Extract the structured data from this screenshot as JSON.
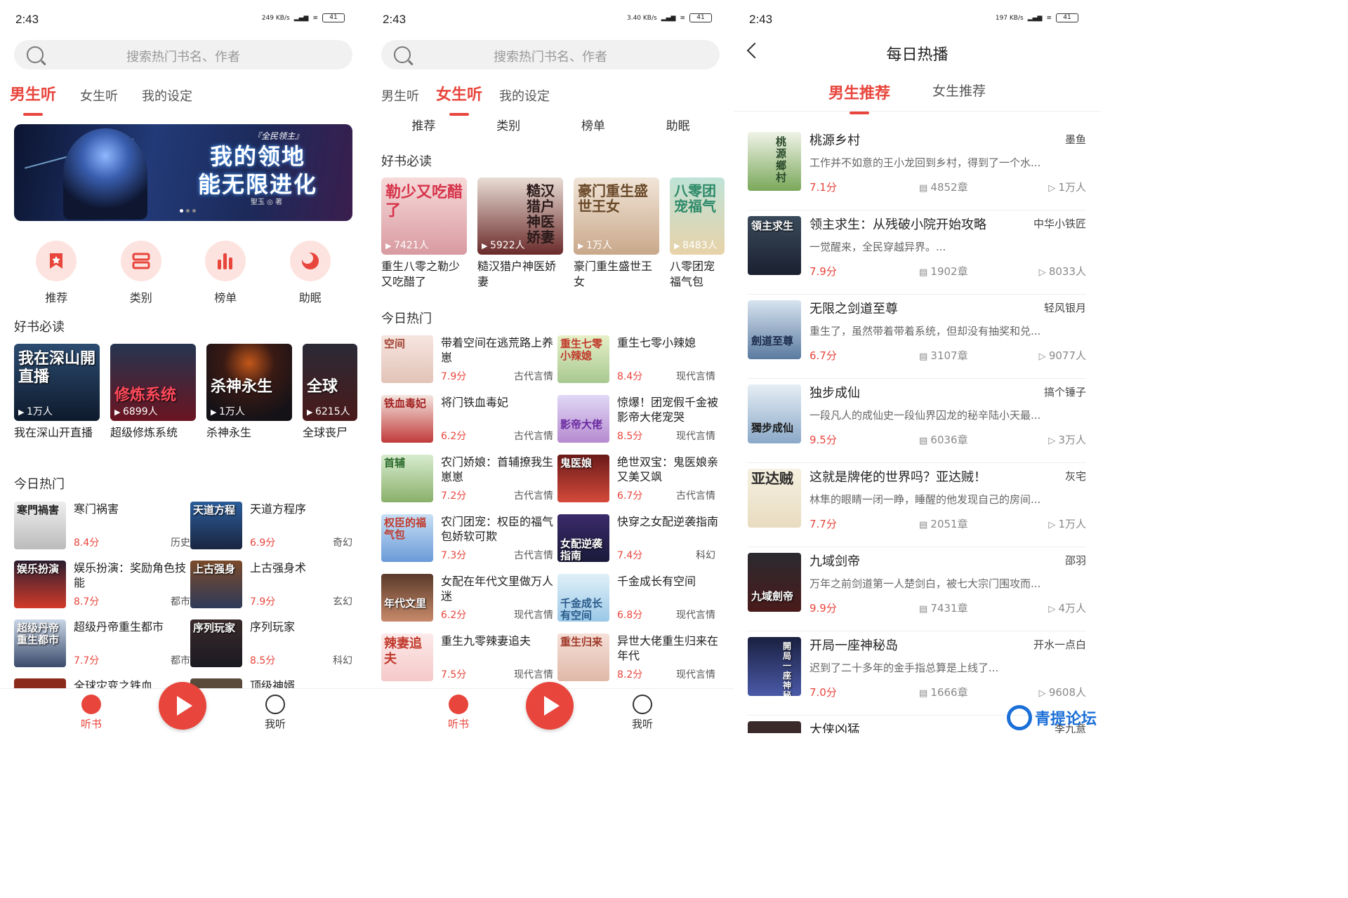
{
  "status": {
    "time": "2:43",
    "speed1": "249 KB/s",
    "speed2": "3.40 KB/s",
    "speed3": "197 KB/s",
    "battery": "41"
  },
  "search": {
    "placeholder": "搜索热门书名、作者"
  },
  "tabs": {
    "male": "男生听",
    "female": "女生听",
    "settings": "我的设定"
  },
  "banner": {
    "tag": "『全民领主』",
    "title_line1": "我的领地",
    "title_line2": "能无限进化",
    "author": "聖玉 ◎ 著"
  },
  "quick": [
    "推荐",
    "类别",
    "榜单",
    "助眠"
  ],
  "sections": {
    "must_read": "好书必读",
    "today_hot": "今日热门"
  },
  "screen1": {
    "must_read": [
      {
        "cover": "我在深山開直播",
        "plays": "1万人",
        "name": "我在深山开直播"
      },
      {
        "cover": "修炼系统",
        "plays": "6899人",
        "name": "超级修炼系统"
      },
      {
        "cover": "杀神永生",
        "plays": "1万人",
        "name": "杀神永生"
      },
      {
        "cover": "全球",
        "plays": "6215人",
        "name": "全球丧尸"
      }
    ],
    "hot": [
      {
        "cover": "寒門禍害",
        "title": "寒门祸害",
        "score": "8.4分",
        "genre": "历史"
      },
      {
        "cover": "天道方程",
        "title": "天道方程序",
        "score": "6.9分",
        "genre": "奇幻"
      },
      {
        "cover": "娱乐扮演",
        "title": "娱乐扮演：奖励角色技能",
        "score": "8.7分",
        "genre": "都市"
      },
      {
        "cover": "上古强身",
        "title": "上古强身术",
        "score": "7.9分",
        "genre": "玄幻"
      },
      {
        "cover": "超级丹帝重生都市",
        "title": "超级丹帝重生都市",
        "score": "7.7分",
        "genre": "都市"
      },
      {
        "cover": "序列玩家",
        "title": "序列玩家",
        "score": "8.5分",
        "genre": "科幻"
      },
      {
        "cover": "",
        "title": "全球灾变之铁血...",
        "score": "",
        "genre": ""
      },
      {
        "cover": "",
        "title": "顶级神婿",
        "score": "",
        "genre": ""
      }
    ]
  },
  "screen2": {
    "subtabs": [
      "推荐",
      "类别",
      "榜单",
      "助眠"
    ],
    "must_read": [
      {
        "cover": "勒少又吃醋了",
        "plays": "7421人",
        "name": "重生八零之勒少又吃醋了"
      },
      {
        "cover": "糙汉猎户神医娇妻",
        "plays": "5922人",
        "name": "糙汉猎户神医娇妻"
      },
      {
        "cover": "豪门重生盛世王女",
        "plays": "1万人",
        "name": "豪门重生盛世王女"
      },
      {
        "cover": "八零团宠福气",
        "plays": "8483人",
        "name": "八零团宠福气包"
      }
    ],
    "hot": [
      {
        "cover": "空间",
        "title": "带着空间在逃荒路上养崽",
        "score": "7.9分",
        "genre": "古代言情"
      },
      {
        "cover": "重生七零小辣媳",
        "title": "重生七零小辣媳",
        "score": "8.4分",
        "genre": "现代言情"
      },
      {
        "cover": "铁血毒妃",
        "title": "将门铁血毒妃",
        "score": "6.2分",
        "genre": "古代言情"
      },
      {
        "cover": "影帝大佬",
        "title": "惊爆！团宠假千金被影帝大佬宠哭",
        "score": "8.5分",
        "genre": "现代言情"
      },
      {
        "cover": "首辅",
        "title": "农门娇娘：首辅撩我生崽崽",
        "score": "7.2分",
        "genre": "古代言情"
      },
      {
        "cover": "鬼医娘",
        "title": "绝世双宝：鬼医娘亲又美又飒",
        "score": "6.7分",
        "genre": "古代言情"
      },
      {
        "cover": "权臣的福气包",
        "title": "农门团宠：权臣的福气包娇软可欺",
        "score": "7.3分",
        "genre": "古代言情"
      },
      {
        "cover": "女配逆袭指南",
        "title": "快穿之女配逆袭指南",
        "score": "7.4分",
        "genre": "科幻"
      },
      {
        "cover": "年代文里",
        "title": "女配在年代文里做万人迷",
        "score": "6.2分",
        "genre": "现代言情"
      },
      {
        "cover": "千金成长有空间",
        "title": "千金成长有空间",
        "score": "6.8分",
        "genre": "现代言情"
      },
      {
        "cover": "辣妻追夫",
        "title": "重生九零辣妻追夫",
        "score": "7.5分",
        "genre": "现代言情"
      },
      {
        "cover": "重生归来",
        "title": "异世大佬重生归来在年代",
        "score": "8.2分",
        "genre": "现代言情"
      }
    ]
  },
  "nav": {
    "listen": "听书",
    "mine": "我听"
  },
  "screen3": {
    "title": "每日热播",
    "tabs": {
      "male": "男生推荐",
      "female": "女生推荐"
    },
    "list": [
      {
        "cover": "桃源鄉村",
        "title": "桃源乡村",
        "author": "墨鱼",
        "desc": "工作并不如意的王小龙回到乡村，得到了一个水...",
        "score": "7.1分",
        "chapters": "4852章",
        "plays": "1万人"
      },
      {
        "cover": "領主求生",
        "title": "领主求生：从残破小院开始攻略",
        "author": "中华小铁匠",
        "desc": "一觉醒来，全民穿越异界。...",
        "score": "7.9分",
        "chapters": "1902章",
        "plays": "8033人"
      },
      {
        "cover": "劍道至尊",
        "title": "无限之剑道至尊",
        "author": "轻风银月",
        "desc": "重生了，虽然带着带着系统，但却没有抽奖和兑...",
        "score": "6.7分",
        "chapters": "3107章",
        "plays": "9077人"
      },
      {
        "cover": "獨步成仙",
        "title": "独步成仙",
        "author": "搞个锤子",
        "desc": "一段凡人的成仙史一段仙界囚龙的秘辛陆小天最...",
        "score": "9.5分",
        "chapters": "6036章",
        "plays": "3万人"
      },
      {
        "cover": "亚达贼",
        "title": "这就是牌佬的世界吗？亚达贼！",
        "author": "灰宅",
        "desc": "林隼的眼睛一闭一睁，睡醒的他发现自己的房间...",
        "score": "7.7分",
        "chapters": "2051章",
        "plays": "1万人"
      },
      {
        "cover": "九域劍帝",
        "title": "九域剑帝",
        "author": "邵羽",
        "desc": "万年之前剑道第一人楚剑白，被七大宗门围攻而...",
        "score": "9.9分",
        "chapters": "7431章",
        "plays": "4万人"
      },
      {
        "cover": "開局一座神秘島",
        "title": "开局一座神秘岛",
        "author": "开水一点白",
        "desc": "迟到了二十多年的金手指总算是上线了...",
        "score": "7.0分",
        "chapters": "1666章",
        "plays": "9608人"
      },
      {
        "cover": "",
        "title": "大侠凶猛",
        "author": "李九意",
        "desc": "",
        "score": "",
        "chapters": "",
        "plays": ""
      }
    ]
  },
  "watermark": "青提论坛",
  "colors": {
    "accent": "#e8453c",
    "accent_light": "#fde3df",
    "watermark": "#1a6fd8"
  }
}
